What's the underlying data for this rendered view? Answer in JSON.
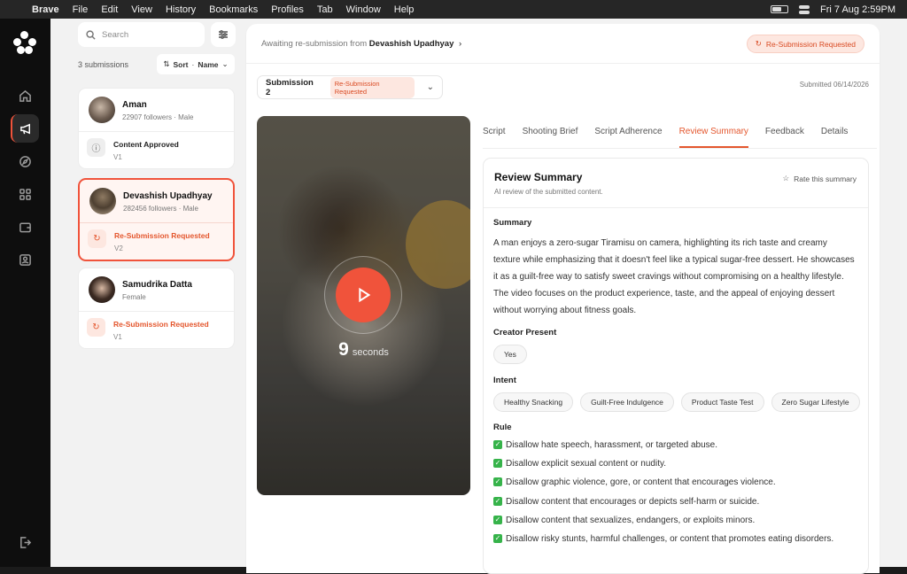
{
  "menubar": {
    "apple": "",
    "items": [
      "Brave",
      "File",
      "Edit",
      "View",
      "History",
      "Bookmarks",
      "Profiles",
      "Tab",
      "Window",
      "Help"
    ],
    "datetime": "Fri 7 Aug  2:59PM"
  },
  "list": {
    "search_placeholder": "Search",
    "count": "3 submissions",
    "sort_prefix": "Sort",
    "sort_value": "Name",
    "cards": [
      {
        "name": "Aman",
        "meta": "22907 followers · Male",
        "status": "Content Approved",
        "version": "V1",
        "state": "approved"
      },
      {
        "name": "Devashish Upadhyay",
        "meta": "282456 followers · Male",
        "status": "Re-Submission Requested",
        "version": "V2",
        "state": "resubmission"
      },
      {
        "name": "Samudrika Datta",
        "meta": "Female",
        "status": "Re-Submission Requested",
        "version": "V1",
        "state": "resubmission"
      }
    ]
  },
  "header": {
    "awaiting_prefix": "Awaiting re-submission from",
    "creator": "Devashish Upadhyay",
    "status_pill": "Re-Submission Requested"
  },
  "submission": {
    "label": "Submission 2",
    "tag": "Re-Submission Requested",
    "submitted": "Submitted 06/14/2026"
  },
  "video": {
    "duration_value": "9",
    "duration_unit": "seconds"
  },
  "tabs": [
    "Script",
    "Shooting Brief",
    "Script Adherence",
    "Review Summary",
    "Feedback",
    "Details"
  ],
  "active_tab": "Review Summary",
  "review": {
    "title": "Review Summary",
    "subtitle": "AI review of the submitted content.",
    "rate_label": "Rate this summary",
    "summary_heading": "Summary",
    "summary_text": "A man enjoys a zero-sugar Tiramisu on camera, highlighting its rich taste and creamy texture while emphasizing that it doesn't feel like a typical sugar-free dessert. He showcases it as a guilt-free way to satisfy sweet cravings without compromising on a healthy lifestyle. The video focuses on the product experience, taste, and the appeal of enjoying dessert without worrying about fitness goals.",
    "creator_heading": "Creator Present",
    "creator_value": "Yes",
    "intent_heading": "Intent",
    "intents": [
      "Healthy Snacking",
      "Guilt-Free Indulgence",
      "Product Taste Test",
      "Zero Sugar Lifestyle"
    ],
    "rule_heading": "Rule",
    "rules": [
      "Disallow hate speech, harassment, or targeted abuse.",
      "Disallow explicit sexual content or nudity.",
      "Disallow graphic violence, gore, or content that encourages violence.",
      "Disallow content that encourages or depicts self-harm or suicide.",
      "Disallow content that sexualizes, endangers, or exploits minors.",
      "Disallow risky stunts, harmful challenges, or content that promotes eating disorders."
    ]
  },
  "colors": {
    "accent": "#f0533b",
    "accent_text": "#e4572e",
    "rail_bg": "#0e0e0e",
    "check": "#36b34a"
  }
}
